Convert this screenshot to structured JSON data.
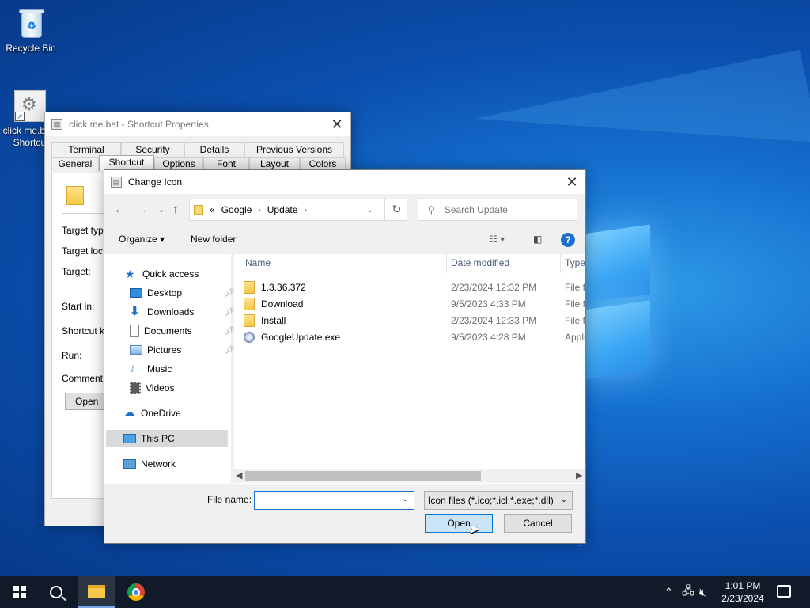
{
  "desktop": {
    "icons": [
      {
        "label": "Recycle Bin"
      },
      {
        "label": "click me.bat - Shortcut"
      }
    ]
  },
  "properties_window": {
    "title": "click me.bat - Shortcut Properties",
    "tabs_row1": [
      "Terminal",
      "Security",
      "Details",
      "Previous Versions"
    ],
    "tabs_row2": [
      "General",
      "Shortcut",
      "Options",
      "Font",
      "Layout",
      "Colors"
    ],
    "active_tab": "Shortcut",
    "fields": [
      "Target typ",
      "Target loc",
      "Target:",
      "Start in:",
      "Shortcut k",
      "Run:",
      "Comment:"
    ],
    "open_button": "Open"
  },
  "dialog": {
    "title": "Change Icon",
    "breadcrumb": [
      "«",
      "Google",
      "Update"
    ],
    "search_placeholder": "Search Update",
    "organize": "Organize",
    "new_folder": "New folder",
    "help": "?",
    "nav": {
      "quick_access": "Quick access",
      "desktop": "Desktop",
      "downloads": "Downloads",
      "documents": "Documents",
      "pictures": "Pictures",
      "music": "Music",
      "videos": "Videos",
      "onedrive": "OneDrive",
      "this_pc": "This PC",
      "network": "Network"
    },
    "columns": {
      "name": "Name",
      "date": "Date modified",
      "type": "Type"
    },
    "files": [
      {
        "name": "1.3.36.372",
        "date": "2/23/2024 12:32 PM",
        "type": "File fo",
        "kind": "folder"
      },
      {
        "name": "Download",
        "date": "9/5/2023 4:33 PM",
        "type": "File fo",
        "kind": "folder"
      },
      {
        "name": "Install",
        "date": "2/23/2024 12:33 PM",
        "type": "File fo",
        "kind": "folder"
      },
      {
        "name": "GoogleUpdate.exe",
        "date": "9/5/2023 4:28 PM",
        "type": "Appli",
        "kind": "exe"
      }
    ],
    "file_name_label": "File name:",
    "file_name_value": "",
    "file_type": "Icon files (*.ico;*.icl;*.exe;*.dll)",
    "open_button": "Open",
    "cancel_button": "Cancel"
  },
  "taskbar": {
    "time": "1:01 PM",
    "date": "2/23/2024"
  },
  "colors": {
    "accent": "#0078d7",
    "taskbar": "#101a28"
  }
}
